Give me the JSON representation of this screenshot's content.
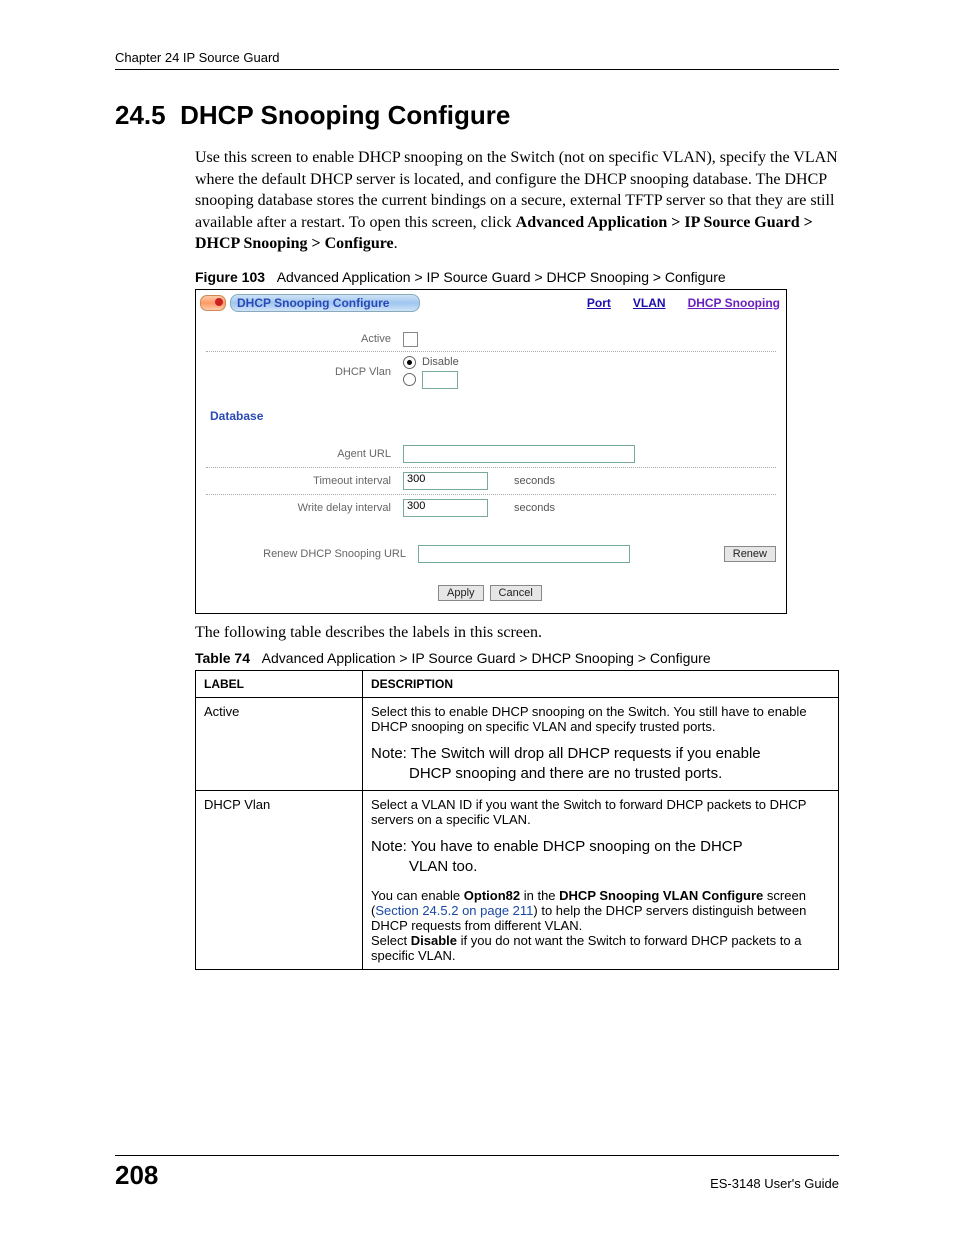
{
  "header": {
    "chapter": "Chapter 24 IP Source Guard"
  },
  "section": {
    "number": "24.5",
    "title": "DHCP Snooping Configure",
    "intro_1": "Use this screen to enable DHCP snooping on the Switch (not on specific VLAN), specify the VLAN where the default DHCP server is located, and configure the DHCP snooping database. The DHCP snooping database stores the current bindings on a secure, external TFTP server so that they are still available after a restart. To open this screen, click ",
    "intro_bold": "Advanced Application > IP Source Guard > DHCP Snooping > Configure",
    "intro_2": "."
  },
  "figure": {
    "label": "Figure 103",
    "caption": "Advanced Application > IP Source Guard > DHCP Snooping > Configure"
  },
  "screenshot": {
    "title": "DHCP Snooping Configure",
    "links": {
      "port": "Port",
      "vlan": "VLAN",
      "snooping": "DHCP Snooping"
    },
    "rows": {
      "active": "Active",
      "dhcp_vlan": "DHCP Vlan",
      "disable": "Disable",
      "database": "Database",
      "agent_url": "Agent URL",
      "timeout": "Timeout interval",
      "timeout_val": "300",
      "write_delay": "Write delay interval",
      "write_delay_val": "300",
      "seconds": "seconds",
      "renew_label": "Renew DHCP Snooping URL",
      "renew_btn": "Renew",
      "apply": "Apply",
      "cancel": "Cancel"
    }
  },
  "post_figure": "The following table describes the labels in this screen.",
  "table": {
    "label": "Table 74",
    "caption": "Advanced Application > IP Source Guard > DHCP Snooping > Configure",
    "head": {
      "c1": "LABEL",
      "c2": "DESCRIPTION"
    },
    "rows": [
      {
        "label": "Active",
        "desc_1": "Select this to enable DHCP snooping on the Switch. You still have to enable DHCP snooping on specific VLAN and specify trusted ports.",
        "note": "Note: The Switch will drop all DHCP requests if you enable",
        "note_2": "DHCP snooping and there are no trusted ports."
      },
      {
        "label": "DHCP Vlan",
        "desc_1": "Select a VLAN ID if you want the Switch to forward DHCP packets to DHCP servers on a specific VLAN.",
        "note": "Note: You have to enable DHCP snooping on the DHCP",
        "note_2": "VLAN too.",
        "desc_2a": "You can enable ",
        "desc_2a_b1": "Option82",
        "desc_2a_mid": " in the ",
        "desc_2a_b2": "DHCP Snooping VLAN Configure",
        "desc_2a_end": " screen (",
        "xref": "Section 24.5.2 on page 211",
        "desc_2a_tail": ") to help the DHCP servers distinguish between DHCP requests from different VLAN.",
        "desc_3a": "Select ",
        "desc_3b": "Disable",
        "desc_3c": " if you do not want the Switch to forward DHCP packets to a specific VLAN."
      }
    ]
  },
  "footer": {
    "page": "208",
    "guide": "ES-3148 User's Guide"
  }
}
